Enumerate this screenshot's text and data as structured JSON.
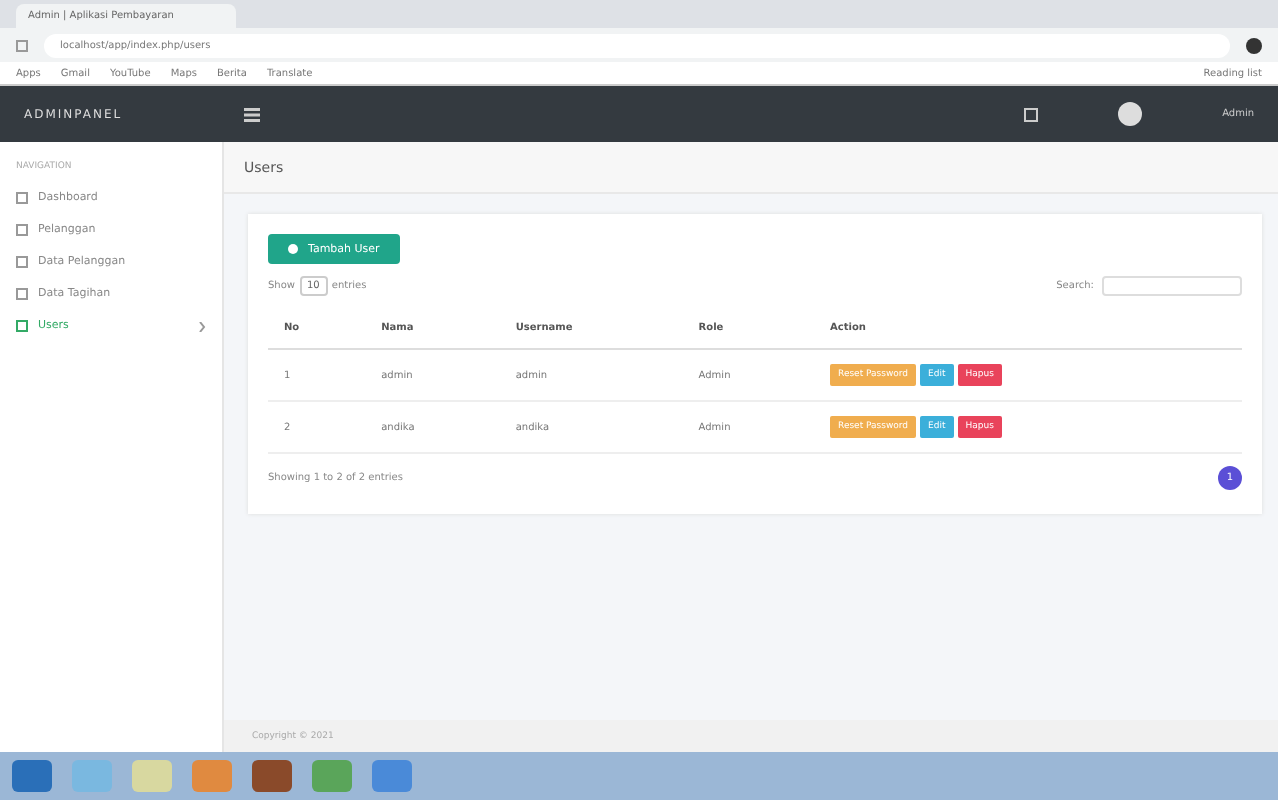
{
  "browser": {
    "tab_title": "Admin | Aplikasi Pembayaran",
    "url": "localhost/app/index.php/users",
    "bookmarks": [
      "Apps",
      "Gmail",
      "YouTube",
      "Maps",
      "Berita",
      "Translate"
    ],
    "reading_list": "Reading list"
  },
  "header": {
    "brand": "ADMINPANEL",
    "user": "Admin"
  },
  "sidebar": {
    "section": "NAVIGATION",
    "items": [
      {
        "label": "Dashboard",
        "selected": false,
        "has_caret": false
      },
      {
        "label": "Pelanggan",
        "selected": false,
        "has_caret": false
      },
      {
        "label": "Data Pelanggan",
        "selected": false,
        "has_caret": false
      },
      {
        "label": "Data Tagihan",
        "selected": false,
        "has_caret": false
      },
      {
        "label": "Users",
        "selected": true,
        "has_caret": true
      }
    ]
  },
  "page_title": "Users",
  "add_button": "Tambah User",
  "show_entries": {
    "prefix": "Show",
    "value": "10",
    "suffix": "entries"
  },
  "search_label": "Search:",
  "table": {
    "columns": [
      "No",
      "Nama",
      "Username",
      "Role",
      "Action"
    ],
    "rows": [
      {
        "cells": [
          "1",
          "admin",
          "admin",
          "Admin"
        ],
        "actions": [
          "Reset Password",
          "Edit",
          "Hapus"
        ]
      },
      {
        "cells": [
          "2",
          "andika",
          "andika",
          "Admin"
        ],
        "actions": [
          "Reset Password",
          "Edit",
          "Hapus"
        ]
      }
    ]
  },
  "info": "Showing 1 to 2 of 2 entries",
  "pagination": {
    "current": "1"
  },
  "footer": "Copyright © 2021"
}
